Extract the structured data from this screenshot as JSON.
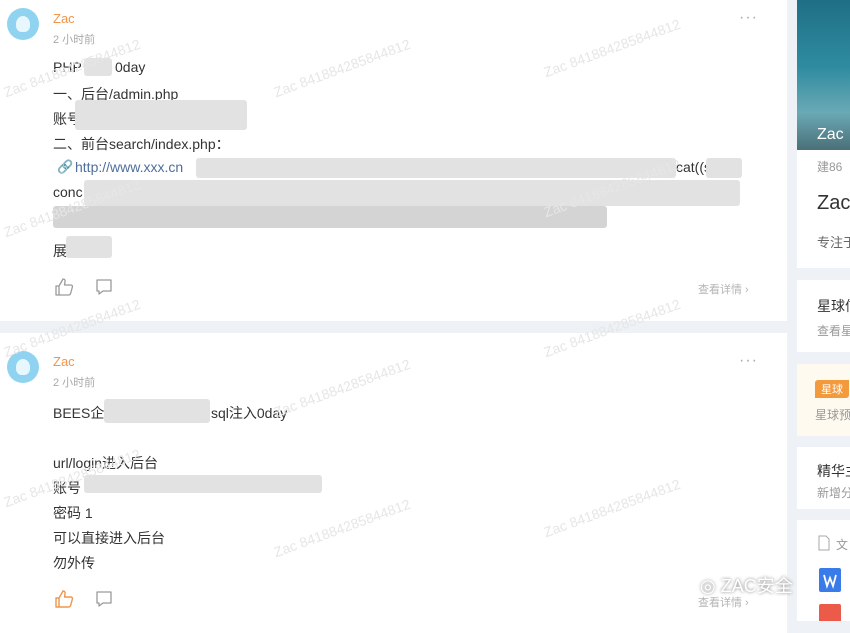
{
  "posts": [
    {
      "author": "Zac",
      "time": "2 小时前",
      "more": "···",
      "lines": [
        "PHP",
        "0day",
        "一、后台/admin.php",
        "账号",
        "二、前台search/index.php：",
        "http://www.xxx.cn",
        "cat((sel",
        "conc",
        "展"
      ],
      "detail": "查看详情 ›"
    },
    {
      "author": "Zac",
      "time": "2 小时前",
      "more": "···",
      "lines": [
        "BEES企",
        "sql注入0day",
        "url/login进入后台",
        "账号",
        "密码 1",
        "可以直接进入后台",
        "勿外传"
      ],
      "detail": "查看详情 ›"
    }
  ],
  "watermark": "Zac 841884285844812",
  "sidebar": {
    "banner_name": "Zac",
    "profile_sub": "建86",
    "profile_name": "Zac",
    "profile_desc": "专注于",
    "planet_title": "星球信",
    "planet_sub": "查看星",
    "badge": "星球",
    "badge_sub": "星球预",
    "essence_title": "精华主",
    "essence_sub": "新增分",
    "files_label": "文"
  },
  "brand": "ZAC安全",
  "colors": {
    "author": "#f0954a",
    "liked": "#f0954a",
    "link": "#4e6e9e"
  }
}
